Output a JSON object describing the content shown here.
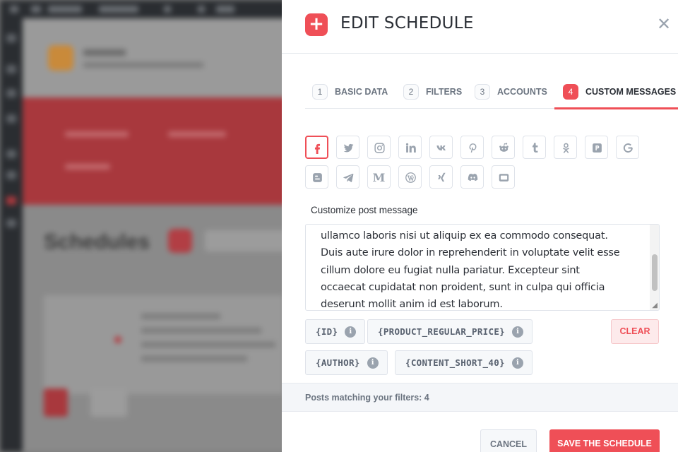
{
  "modal": {
    "title": "EDIT SCHEDULE",
    "header_icon": "plus-icon",
    "close_icon": "close-icon"
  },
  "tabs": [
    {
      "num": "1",
      "label": "BASIC DATA",
      "active": false
    },
    {
      "num": "2",
      "label": "FILTERS",
      "active": false
    },
    {
      "num": "3",
      "label": "ACCOUNTS",
      "active": false
    },
    {
      "num": "4",
      "label": "CUSTOM MESSAGES",
      "active": true
    }
  ],
  "social_networks": [
    {
      "name": "facebook",
      "icon": "facebook-icon",
      "active": true
    },
    {
      "name": "twitter",
      "icon": "twitter-icon",
      "active": false
    },
    {
      "name": "instagram",
      "icon": "instagram-icon",
      "active": false
    },
    {
      "name": "linkedin",
      "icon": "linkedin-icon",
      "active": false
    },
    {
      "name": "vk",
      "icon": "vk-icon",
      "active": false
    },
    {
      "name": "pinterest",
      "icon": "pinterest-icon",
      "active": false
    },
    {
      "name": "reddit",
      "icon": "reddit-icon",
      "active": false
    },
    {
      "name": "tumblr",
      "icon": "tumblr-icon",
      "active": false
    },
    {
      "name": "odnoklassniki",
      "icon": "odnoklassniki-icon",
      "active": false
    },
    {
      "name": "plurk",
      "icon": "plurk-icon",
      "active": false
    },
    {
      "name": "google",
      "icon": "google-icon",
      "active": false
    },
    {
      "name": "blogger",
      "icon": "blogger-icon",
      "active": false
    },
    {
      "name": "telegram",
      "icon": "telegram-icon",
      "active": false
    },
    {
      "name": "medium",
      "icon": "medium-icon",
      "active": false
    },
    {
      "name": "wordpress",
      "icon": "wordpress-icon",
      "active": false
    },
    {
      "name": "xing",
      "icon": "xing-icon",
      "active": false
    },
    {
      "name": "discord",
      "icon": "discord-icon",
      "active": false
    },
    {
      "name": "youtube",
      "icon": "youtube-icon",
      "active": false
    }
  ],
  "message": {
    "label": "Customize post message",
    "text": "ullamco laboris nisi ut aliquip ex ea commodo consequat.\nDuis aute irure dolor in reprehenderit in voluptate velit esse\ncillum dolore eu fugiat nulla pariatur. Excepteur sint\noccaecat cupidatat non proident, sunt in culpa qui officia\ndeserunt mollit anim id est laborum."
  },
  "keywords": [
    {
      "label": "{ID}"
    },
    {
      "label": "{PRODUCT_REGULAR_PRICE}"
    },
    {
      "label": "{AUTHOR}"
    },
    {
      "label": "{CONTENT_SHORT_40}"
    }
  ],
  "clear_label": "CLEAR",
  "posts_matching": "Posts matching your filters: 4",
  "cancel_label": "CANCEL",
  "save_label": "SAVE THE SCHEDULE",
  "background": {
    "page_title": "Schedules"
  },
  "colors": {
    "accent": "#ef4f57",
    "text": "#2b2f36",
    "muted": "#6b7480",
    "border": "#dfe3ea"
  }
}
